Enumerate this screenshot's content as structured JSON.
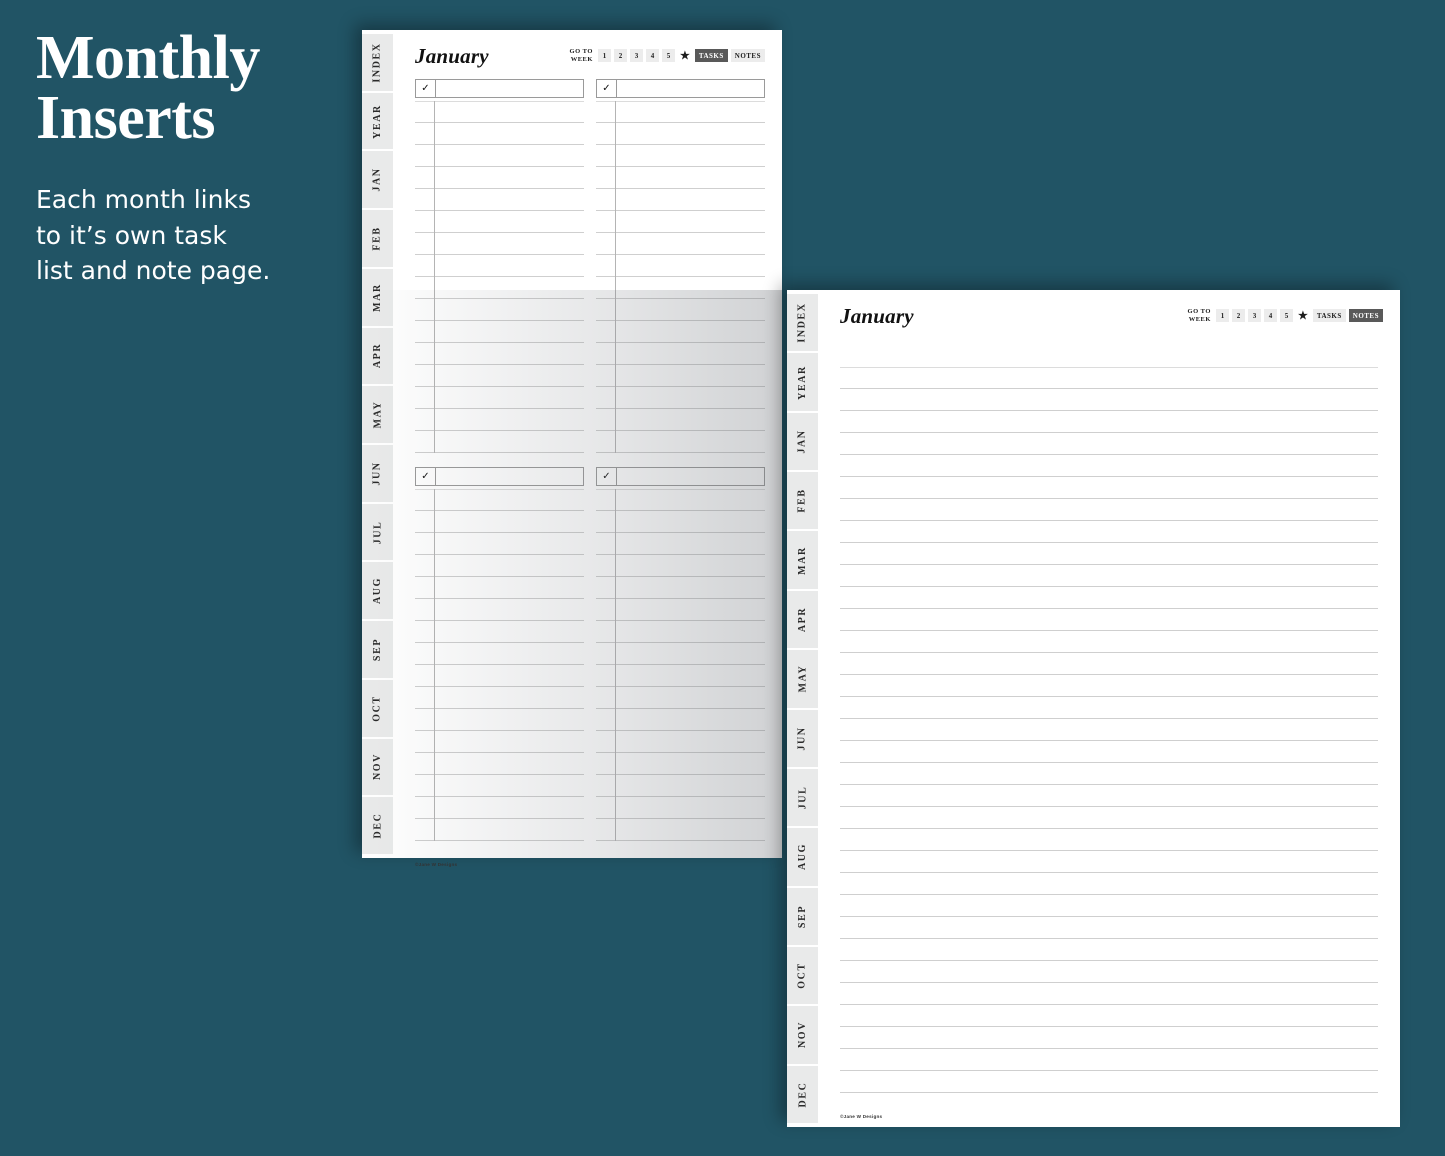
{
  "promo": {
    "headline": "Monthly\nInserts",
    "subcopy": "Each month links\nto it’s own task\nlist and note page."
  },
  "theme": {
    "background": "#215465",
    "page": "#ffffff",
    "tab": "#e9eaea",
    "rule": "#cfcfcf",
    "active_nav": "#595959"
  },
  "tabs": [
    {
      "label": "INDEX"
    },
    {
      "label": "YEAR"
    },
    {
      "label": "JAN"
    },
    {
      "label": "FEB"
    },
    {
      "label": "MAR"
    },
    {
      "label": "APR"
    },
    {
      "label": "MAY"
    },
    {
      "label": "JUN"
    },
    {
      "label": "JUL"
    },
    {
      "label": "AUG"
    },
    {
      "label": "SEP"
    },
    {
      "label": "OCT"
    },
    {
      "label": "NOV"
    },
    {
      "label": "DEC"
    }
  ],
  "task_page": {
    "title": "January",
    "nav": {
      "goto_label": "GO TO\nWEEK",
      "weeks": [
        "1",
        "2",
        "3",
        "4",
        "5"
      ],
      "star_icon": "★",
      "tasks_label": "TASKS",
      "notes_label": "NOTES",
      "active": "TASKS"
    },
    "checkbox_icon": "✓",
    "blocks": [
      {
        "columns": 2,
        "header_value": "",
        "header_placeholder": "",
        "line_count": 16
      },
      {
        "columns": 2,
        "header_value": "",
        "header_placeholder": "",
        "line_count": 16
      }
    ],
    "credit": "©Jane W Designs"
  },
  "notes_page": {
    "title": "January",
    "nav": {
      "goto_label": "GO TO\nWEEK",
      "weeks": [
        "1",
        "2",
        "3",
        "4",
        "5"
      ],
      "star_icon": "★",
      "tasks_label": "TASKS",
      "notes_label": "NOTES",
      "active": "NOTES"
    },
    "line_count": 33,
    "credit": "©Jane W Designs"
  }
}
